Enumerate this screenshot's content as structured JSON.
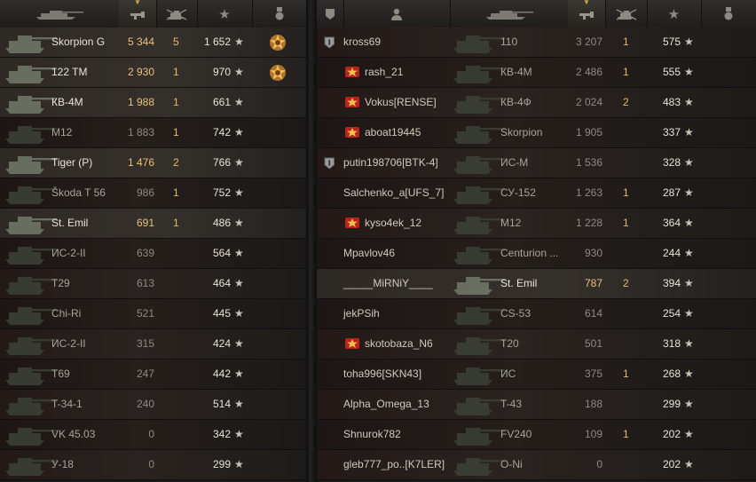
{
  "left_header": {
    "tank_col_icon": "tank-icon",
    "damage_col_icon": "damage-icon",
    "kills_col_icon": "destroyed-tank-icon",
    "xp_col_icon": "star-icon",
    "achievements_col_icon": "medal-icon"
  },
  "right_header": {
    "squad_col_icon": "squad-icon",
    "player_col_icon": "player-icon",
    "tank_col_icon": "tank-icon",
    "damage_col_icon": "damage-icon",
    "kills_col_icon": "destroyed-tank-icon",
    "xp_col_icon": "star-icon",
    "achievements_col_icon": "medal-icon"
  },
  "left_rows": [
    {
      "tank": "Skorpion G",
      "damage": "5 344",
      "kills": "5",
      "xp": "1 652",
      "medal": "top-gun-medal",
      "highlight": true,
      "gold": true
    },
    {
      "tank": "122 TM",
      "damage": "2 930",
      "kills": "1",
      "xp": "970",
      "medal": "top-gun-medal",
      "highlight": true,
      "gold": true
    },
    {
      "tank": "КВ-4М",
      "damage": "1 988",
      "kills": "1",
      "xp": "661",
      "medal": "",
      "highlight": true,
      "gold": true
    },
    {
      "tank": "M12",
      "damage": "1 883",
      "kills": "1",
      "xp": "742",
      "medal": "",
      "highlight": false,
      "gold": false
    },
    {
      "tank": "Tiger (P)",
      "damage": "1 476",
      "kills": "2",
      "xp": "766",
      "medal": "",
      "highlight": true,
      "gold": true
    },
    {
      "tank": "Škoda T 56",
      "damage": "986",
      "kills": "1",
      "xp": "752",
      "medal": "",
      "highlight": false,
      "gold": false
    },
    {
      "tank": "St. Emil",
      "damage": "691",
      "kills": "1",
      "xp": "486",
      "medal": "",
      "highlight": true,
      "gold": true
    },
    {
      "tank": "ИС-2-II",
      "damage": "639",
      "kills": "",
      "xp": "564",
      "medal": "",
      "highlight": false,
      "gold": false
    },
    {
      "tank": "T29",
      "damage": "613",
      "kills": "",
      "xp": "464",
      "medal": "",
      "highlight": false,
      "gold": false
    },
    {
      "tank": "Chi-Ri",
      "damage": "521",
      "kills": "",
      "xp": "445",
      "medal": "",
      "highlight": false,
      "gold": false
    },
    {
      "tank": "ИС-2-II",
      "damage": "315",
      "kills": "",
      "xp": "424",
      "medal": "",
      "highlight": false,
      "gold": false
    },
    {
      "tank": "T69",
      "damage": "247",
      "kills": "",
      "xp": "442",
      "medal": "",
      "highlight": false,
      "gold": false
    },
    {
      "tank": "T-34-1",
      "damage": "240",
      "kills": "",
      "xp": "514",
      "medal": "",
      "highlight": false,
      "gold": false
    },
    {
      "tank": "VK 45.03",
      "damage": "0",
      "kills": "",
      "xp": "342",
      "medal": "",
      "highlight": false,
      "gold": false
    },
    {
      "tank": "У-18",
      "damage": "0",
      "kills": "",
      "xp": "299",
      "medal": "",
      "highlight": false,
      "gold": false
    }
  ],
  "right_rows": [
    {
      "player": "kross69",
      "badge": "squad-badge",
      "tank": "110",
      "damage": "3 207",
      "kills": "1",
      "xp": "575",
      "gold": false
    },
    {
      "player": "rash_21",
      "badge": "clan-emblem",
      "tank": "КВ-4М",
      "damage": "2 486",
      "kills": "1",
      "xp": "555",
      "gold": false
    },
    {
      "player": "Vokus[RENSE]",
      "badge": "clan-emblem",
      "tank": "КВ-4Ф",
      "damage": "2 024",
      "kills": "2",
      "xp": "483",
      "gold": false
    },
    {
      "player": "aboat19445",
      "badge": "clan-emblem",
      "tank": "Skorpion",
      "damage": "1 905",
      "kills": "",
      "xp": "337",
      "gold": false
    },
    {
      "player": "putin198706[BTK-4]",
      "badge": "squad-badge",
      "tank": "ИС-М",
      "damage": "1 536",
      "kills": "",
      "xp": "328",
      "gold": false
    },
    {
      "player": "Salchenko_a[UFS_7]",
      "badge": "",
      "tank": "СУ-152",
      "damage": "1 263",
      "kills": "1",
      "xp": "287",
      "gold": false
    },
    {
      "player": "kyso4ek_12",
      "badge": "clan-emblem",
      "tank": "M12",
      "damage": "1 228",
      "kills": "1",
      "xp": "364",
      "gold": false
    },
    {
      "player": "Mpavlov46",
      "badge": "",
      "tank": "Centurion ...",
      "damage": "930",
      "kills": "",
      "xp": "244",
      "gold": false
    },
    {
      "player": "_____MiRNiY____",
      "badge": "",
      "tank": "St. Emil",
      "damage": "787",
      "kills": "2",
      "xp": "394",
      "gold": true
    },
    {
      "player": "jekPSih",
      "badge": "",
      "tank": "CS-53",
      "damage": "614",
      "kills": "",
      "xp": "254",
      "gold": false
    },
    {
      "player": "skotobaza_N6",
      "badge": "clan-emblem",
      "tank": "T20",
      "damage": "501",
      "kills": "",
      "xp": "318",
      "gold": false
    },
    {
      "player": "toha996[SKN43]",
      "badge": "",
      "tank": "ИС",
      "damage": "375",
      "kills": "1",
      "xp": "268",
      "gold": false
    },
    {
      "player": "Alpha_Omega_13",
      "badge": "",
      "tank": "T-43",
      "damage": "188",
      "kills": "",
      "xp": "299",
      "gold": false
    },
    {
      "player": "Shnurok782",
      "badge": "",
      "tank": "FV240",
      "damage": "109",
      "kills": "1",
      "xp": "202",
      "gold": false
    },
    {
      "player": "gleb777_po..[K7LER]",
      "badge": "",
      "tank": "O-Ni",
      "damage": "0",
      "kills": "",
      "xp": "202",
      "gold": false
    }
  ],
  "colors": {
    "gold_text": "#e7c27a",
    "dim_text": "#8e8a83",
    "bright_text": "#e8e3d8",
    "header_bg": "#2b2926"
  },
  "xp_star": "★"
}
